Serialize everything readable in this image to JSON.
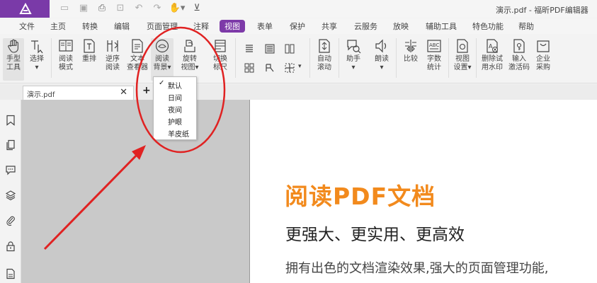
{
  "window": {
    "title": "演示.pdf - 福昕PDF编辑器"
  },
  "quick_access": [
    "folder-icon",
    "save-icon",
    "print-icon",
    "new-page-icon",
    "undo-icon",
    "redo-icon",
    "hand-dropdown-icon",
    "customize-icon"
  ],
  "menu": {
    "items": [
      "文件",
      "主页",
      "转换",
      "编辑",
      "页面管理",
      "注释",
      "视图",
      "表单",
      "保护",
      "共享",
      "云服务",
      "放映",
      "辅助工具",
      "特色功能",
      "帮助"
    ],
    "active": "视图"
  },
  "ribbon": {
    "buttons": [
      {
        "label": "手型\n工具",
        "icon": "hand-icon"
      },
      {
        "label": "选择\n▾",
        "icon": "select-cursor-icon"
      },
      {
        "label": "阅读\n模式",
        "icon": "read-mode-icon"
      },
      {
        "label": "重排",
        "icon": "reflow-icon"
      },
      {
        "label": "逆序\n阅读",
        "icon": "reverse-read-icon"
      },
      {
        "label": "文本\n查看器",
        "icon": "text-viewer-icon"
      },
      {
        "label": "阅读\n背景▾",
        "icon": "read-background-icon"
      },
      {
        "label": "旋转\n视图▾",
        "icon": "rotate-view-icon"
      },
      {
        "label": "切换\n标尺",
        "icon": "ruler-icon"
      },
      {
        "label": "自动\n滚动",
        "icon": "auto-scroll-icon"
      },
      {
        "label": "助手\n▾",
        "icon": "assistant-icon"
      },
      {
        "label": "朗读\n▾",
        "icon": "read-aloud-icon"
      },
      {
        "label": "比较",
        "icon": "compare-icon"
      },
      {
        "label": "字数\n统计",
        "icon": "word-count-icon"
      },
      {
        "label": "视图\n设置▾",
        "icon": "view-settings-icon"
      },
      {
        "label": "删除试\n用水印",
        "icon": "remove-watermark-icon"
      },
      {
        "label": "输入\n激活码",
        "icon": "activation-code-icon"
      },
      {
        "label": "企业\n采购",
        "icon": "enterprise-purchase-icon"
      }
    ],
    "small_icons": [
      "single-page-icon",
      "continuous-page-icon",
      "facing-page-icon",
      "cover-page-icon",
      "split-view-icon",
      "grid-layout-icon"
    ]
  },
  "tabs": {
    "document": "演示.pdf",
    "add": "+",
    "close": "✕"
  },
  "sidebar_icons": [
    "bookmark-icon",
    "pages-icon",
    "comments-icon",
    "layers-icon",
    "attachments-icon",
    "security-icon",
    "document-icon"
  ],
  "dropdown": {
    "items": [
      "默认",
      "日间",
      "夜间",
      "护眼",
      "羊皮纸"
    ],
    "checked_mark": "✓"
  },
  "page": {
    "title": "阅读PDF文档",
    "subtitle": "更强大、更实用、更高效",
    "body": "拥有出色的文档渲染效果,强大的页面管理功能,"
  },
  "colors": {
    "brand": "#7a3aa8",
    "active_tab": "#7d3aa8",
    "title_orange": "#f28a1d",
    "annotation_red": "#e02222",
    "page_gray": "#c9c9c9"
  }
}
